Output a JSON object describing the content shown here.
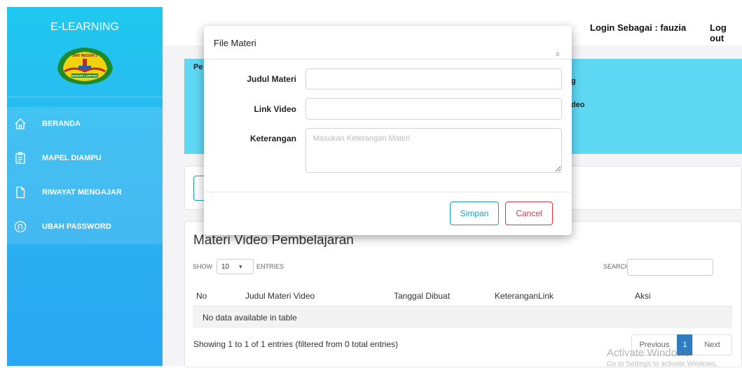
{
  "sidebar": {
    "brand": "E-LEARNING",
    "logo_text": "SMK NEGERI 1",
    "logo_subtext": "BANDAR LAMPUNG",
    "items": [
      {
        "label": "BERANDA",
        "icon": "home-icon"
      },
      {
        "label": "MAPEL DIAMPU",
        "icon": "clipboard-icon"
      },
      {
        "label": "RIWAYAT MENGAJAR",
        "icon": "document-icon"
      },
      {
        "label": "UBAH PASSWORD",
        "icon": "lock-icon"
      }
    ]
  },
  "header": {
    "login_label": "Login Sebagai : fauzia",
    "logout_label": "Log out"
  },
  "info_card": {
    "fragment_left": "Pe",
    "fragment_right_1": "g",
    "fragment_right_2": "deo"
  },
  "table_section": {
    "title": "Materi Video Pembelajaran",
    "show_label": "SHOW",
    "show_value": "10",
    "entries_label": "ENTRIES",
    "search_label": "SEARCH:",
    "columns": [
      "No",
      "Judul Materi Video",
      "Tanggal Dibuat",
      "Keterangan",
      "Link",
      "Aksi"
    ],
    "empty_message": "No data available in table",
    "info": "Showing 1 to 1 of 1 entries (filtered from 0 total entries)",
    "pagination": {
      "previous": "Previous",
      "current": "1",
      "next": "Next"
    }
  },
  "modal": {
    "title": "File Materi",
    "close": "×",
    "fields": {
      "judul_label": "Judul Materi",
      "judul_value": "",
      "link_label": "Link Video",
      "link_value": "",
      "keterangan_label": "Keterangan",
      "keterangan_placeholder": "Masukan Keterangan Materi"
    },
    "save_label": "Simpan",
    "cancel_label": "Cancel"
  },
  "watermark": {
    "line1": "Activate Windows",
    "line2": "Go to Settings to activate Windows."
  },
  "colors": {
    "sidebar": "#2bb6f0",
    "info_card": "#5fd8f4",
    "primary": "#2f7cc3",
    "info_button": "#17a2b8",
    "danger_button": "#dc3545"
  }
}
